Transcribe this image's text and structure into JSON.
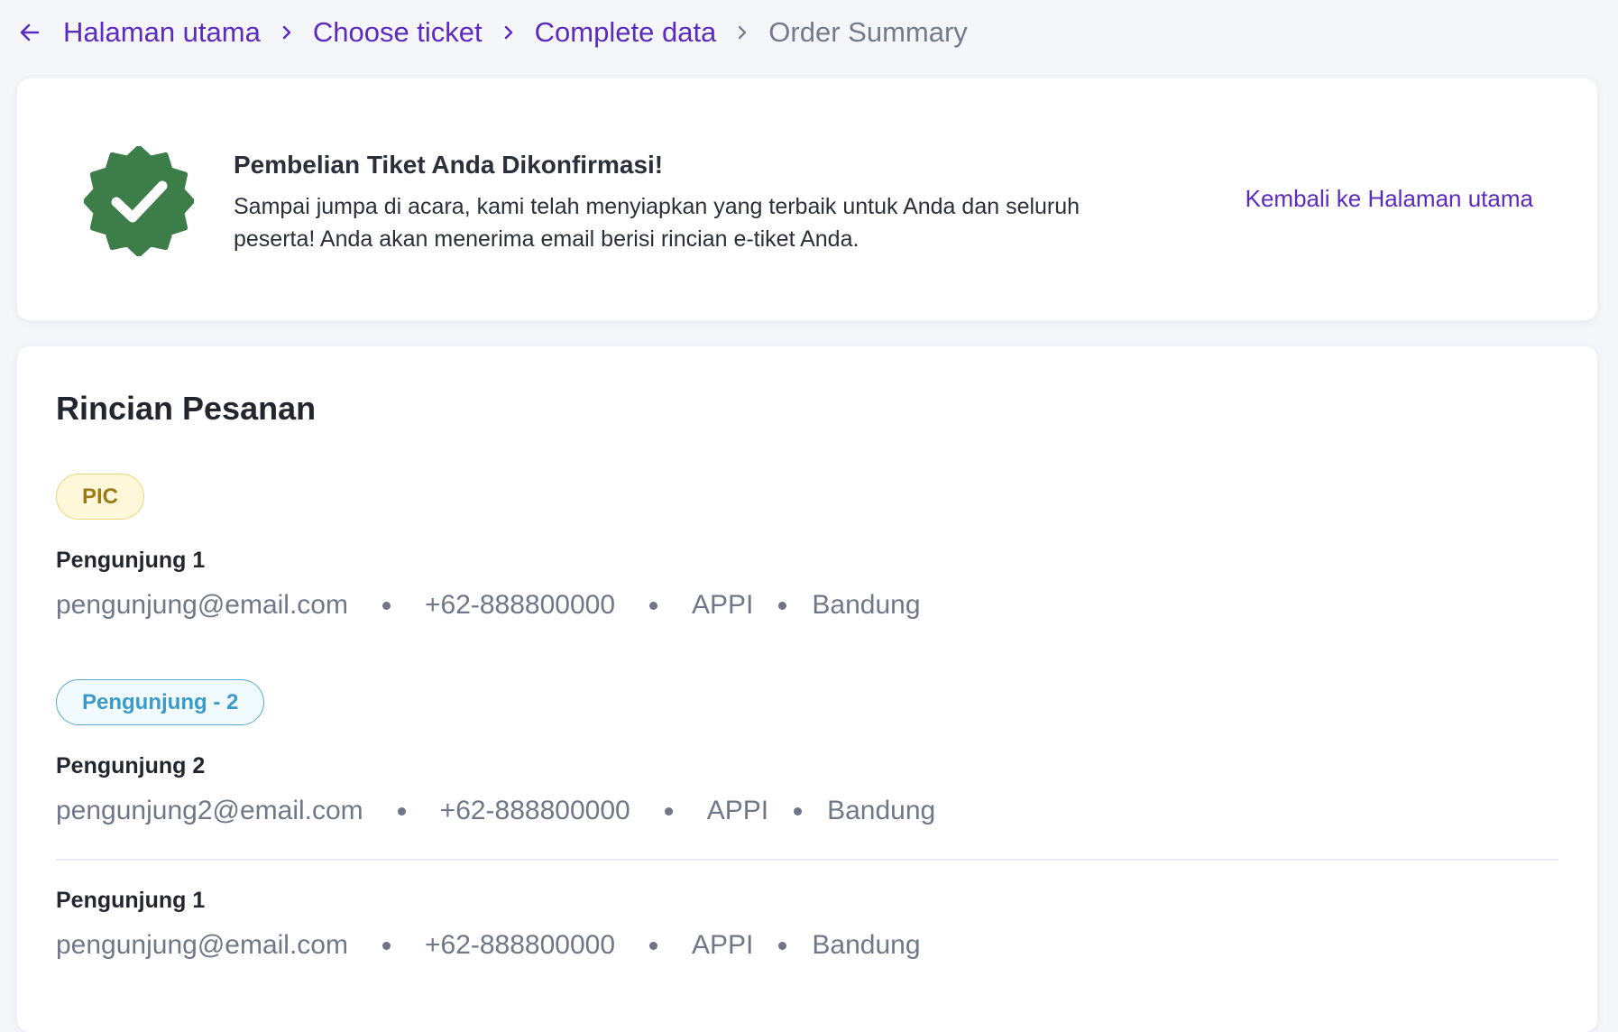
{
  "breadcrumb": {
    "items": [
      "Halaman utama",
      "Choose ticket",
      "Complete data"
    ],
    "current": "Order Summary"
  },
  "confirmation": {
    "title": "Pembelian Tiket Anda Dikonfirmasi!",
    "description": "Sampai jumpa di acara, kami telah menyiapkan yang terbaik untuk Anda dan seluruh peserta! Anda akan menerima email berisi rincian e-tiket Anda.",
    "home_link": "Kembali ke Halaman utama",
    "icon": "verified-badge-icon",
    "icon_color": "#3d7d4a"
  },
  "details": {
    "title": "Rincian Pesanan",
    "groups": [
      {
        "tag": "PIC",
        "visitors": [
          {
            "name": "Pengunjung 1",
            "email": "pengunjung@email.com",
            "phone": "+62-888800000",
            "org": "APPI",
            "city": "Bandung"
          }
        ]
      },
      {
        "tag": "Pengunjung - 2",
        "visitors": [
          {
            "name": "Pengunjung 2",
            "email": "pengunjung2@email.com",
            "phone": "+62-888800000",
            "org": "APPI",
            "city": "Bandung"
          },
          {
            "name": "Pengunjung 1",
            "email": "pengunjung@email.com",
            "phone": "+62-888800000",
            "org": "APPI",
            "city": "Bandung"
          }
        ]
      }
    ]
  },
  "colors": {
    "accent": "#5b2bbf",
    "pic_tag": "#9a7b14",
    "visitor_tag": "#3a9bc8",
    "muted_text": "#707788"
  }
}
